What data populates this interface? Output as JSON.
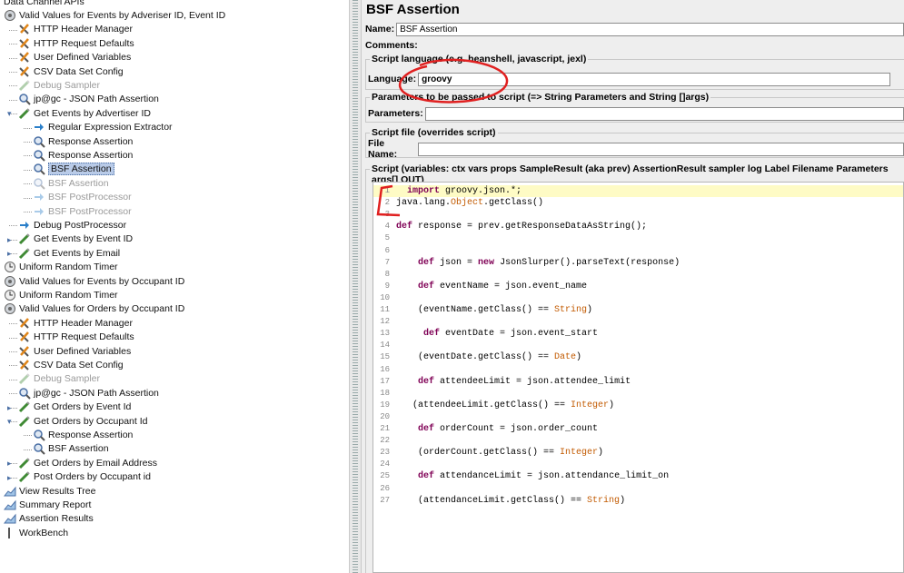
{
  "tree": {
    "items": [
      {
        "label": "Data Channel APIs",
        "icon": "none"
      },
      {
        "label": "Valid Values for Events by Adveriser ID, Event ID",
        "icon": "thread-group-icon"
      },
      {
        "label": "HTTP Header Manager",
        "icon": "config-element-icon"
      },
      {
        "label": "HTTP Request Defaults",
        "icon": "config-element-icon"
      },
      {
        "label": "User Defined Variables",
        "icon": "config-element-icon"
      },
      {
        "label": "CSV Data Set Config",
        "icon": "config-element-icon"
      },
      {
        "label": "Debug Sampler",
        "icon": "sampler-icon",
        "disabled": true
      },
      {
        "label": "jp@gc - JSON Path Assertion",
        "icon": "assertion-icon"
      },
      {
        "label": "Get Events by Advertiser ID",
        "icon": "sampler-icon"
      },
      {
        "label": "Regular Expression Extractor",
        "icon": "post-processor-icon"
      },
      {
        "label": "Response Assertion",
        "icon": "assertion-icon"
      },
      {
        "label": "Response Assertion",
        "icon": "assertion-icon"
      },
      {
        "label": "BSF Assertion",
        "icon": "assertion-icon",
        "selected": true
      },
      {
        "label": "BSF Assertion",
        "icon": "assertion-icon",
        "disabled": true
      },
      {
        "label": "BSF PostProcessor",
        "icon": "post-processor-icon",
        "disabled": true
      },
      {
        "label": "BSF PostProcessor",
        "icon": "post-processor-icon",
        "disabled": true
      },
      {
        "label": "Debug PostProcessor",
        "icon": "post-processor-icon"
      },
      {
        "label": "Get Events by Event ID",
        "icon": "sampler-icon"
      },
      {
        "label": "Get Events by Email",
        "icon": "sampler-icon"
      },
      {
        "label": "Uniform Random Timer",
        "icon": "timer-icon"
      },
      {
        "label": "Valid Values  for Events by Occupant ID",
        "icon": "thread-group-icon"
      },
      {
        "label": "Uniform Random Timer",
        "icon": "timer-icon"
      },
      {
        "label": "Valid Values for Orders by Occupant ID",
        "icon": "thread-group-icon"
      },
      {
        "label": "HTTP Header Manager",
        "icon": "config-element-icon"
      },
      {
        "label": "HTTP Request Defaults",
        "icon": "config-element-icon"
      },
      {
        "label": "User Defined Variables",
        "icon": "config-element-icon"
      },
      {
        "label": "CSV Data Set Config",
        "icon": "config-element-icon"
      },
      {
        "label": "Debug Sampler",
        "icon": "sampler-icon",
        "disabled": true
      },
      {
        "label": "jp@gc - JSON Path Assertion",
        "icon": "assertion-icon"
      },
      {
        "label": "Get Orders by Event Id",
        "icon": "sampler-icon"
      },
      {
        "label": "Get Orders by Occupant Id",
        "icon": "sampler-icon"
      },
      {
        "label": "Response Assertion",
        "icon": "assertion-icon"
      },
      {
        "label": "BSF Assertion",
        "icon": "assertion-icon"
      },
      {
        "label": "Get Orders by Email Address",
        "icon": "sampler-icon"
      },
      {
        "label": "Post Orders by Occupant id",
        "icon": "sampler-icon"
      },
      {
        "label": "View Results Tree",
        "icon": "listener-icon"
      },
      {
        "label": "Summary Report",
        "icon": "listener-icon"
      },
      {
        "label": "Assertion Results",
        "icon": "listener-icon"
      },
      {
        "label": "WorkBench",
        "icon": "workbench-icon"
      }
    ]
  },
  "panel": {
    "title": "BSF Assertion",
    "name_label": "Name:",
    "name_value": "BSF Assertion",
    "comments_label": "Comments:",
    "lang_group": "Script language (e.g. beanshell, javascript, jexl)",
    "lang_label": "Language:",
    "lang_value": "groovy",
    "params_group": "Parameters to be passed to script (=> String Parameters and String []args)",
    "params_label": "Parameters:",
    "file_group": "Script file (overrides script)",
    "file_label": "File Name:",
    "script_group": "Script (variables: ctx vars props SampleResult (aka prev) AssertionResult sampler log Label Filename Parameters args[] OUT)"
  },
  "code": [
    {
      "n": "1",
      "t": "  import groovy.json.*;"
    },
    {
      "n": "2",
      "t": "java.lang.Object.getClass()"
    },
    {
      "n": "3",
      "t": ""
    },
    {
      "n": "4",
      "t": "def response = prev.getResponseDataAsString();"
    },
    {
      "n": "5",
      "t": ""
    },
    {
      "n": "6",
      "t": ""
    },
    {
      "n": "7",
      "t": "    def json = new JsonSlurper().parseText(response)"
    },
    {
      "n": "8",
      "t": ""
    },
    {
      "n": "9",
      "t": "    def eventName = json.event_name"
    },
    {
      "n": "10",
      "t": ""
    },
    {
      "n": "11",
      "t": "    (eventName.getClass() == String)"
    },
    {
      "n": "12",
      "t": ""
    },
    {
      "n": "13",
      "t": "     def eventDate = json.event_start"
    },
    {
      "n": "14",
      "t": ""
    },
    {
      "n": "15",
      "t": "    (eventDate.getClass() == Date)"
    },
    {
      "n": "16",
      "t": ""
    },
    {
      "n": "17",
      "t": "    def attendeeLimit = json.attendee_limit"
    },
    {
      "n": "18",
      "t": ""
    },
    {
      "n": "19",
      "t": "   (attendeeLimit.getClass() == Integer)"
    },
    {
      "n": "20",
      "t": ""
    },
    {
      "n": "21",
      "t": "    def orderCount = json.order_count"
    },
    {
      "n": "22",
      "t": ""
    },
    {
      "n": "23",
      "t": "    (orderCount.getClass() == Integer)"
    },
    {
      "n": "24",
      "t": ""
    },
    {
      "n": "25",
      "t": "    def attendanceLimit = json.attendance_limit_on"
    },
    {
      "n": "26",
      "t": ""
    },
    {
      "n": "27",
      "t": "    (attendanceLimit.getClass() == String)"
    }
  ],
  "colors": {
    "selected": "#b9cbe8",
    "highlight": "#fefbc5",
    "annotation": "#e02020"
  }
}
